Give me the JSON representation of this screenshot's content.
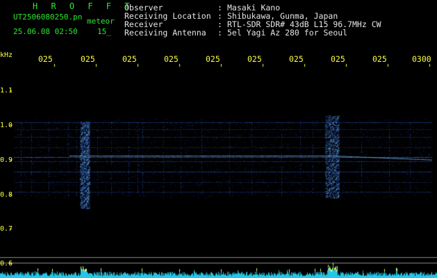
{
  "app": {
    "title": "H R O F F T",
    "filename": "UT2506080250.pn",
    "meteor_label": "meteor",
    "datetime": "25.06.08 02:50",
    "seconds": "15_"
  },
  "header": {
    "observer_label": "Observer",
    "observer_value": "Masaki Kano",
    "location_label": "Receiving Location",
    "location_value": "Shibukawa, Gunma, Japan",
    "receiver_label": "Receiver",
    "receiver_value": "RTL-SDR SDR# 43dB L15 96.7MHz CW",
    "antenna_label": "Receiving Antenna",
    "antenna_value": "5el Yagi Az 280 for Seoul",
    "colon": ":"
  },
  "axis": {
    "y_unit": "kHz",
    "y_ticks": [
      "1.1",
      "1.0",
      "0.9",
      "0.8",
      "0.7",
      "0.6"
    ],
    "x_ticks": [
      "025",
      "025",
      "025",
      "025",
      "025",
      "025",
      "025",
      "025",
      "025",
      "0300"
    ]
  },
  "colors": {
    "background": "#000000",
    "header_text": "#e6e6e6",
    "title_text": "#2ee82e",
    "axis_text": "#ffff40",
    "signal": "#3a6fff",
    "spectrum": "#22c7e6"
  }
}
